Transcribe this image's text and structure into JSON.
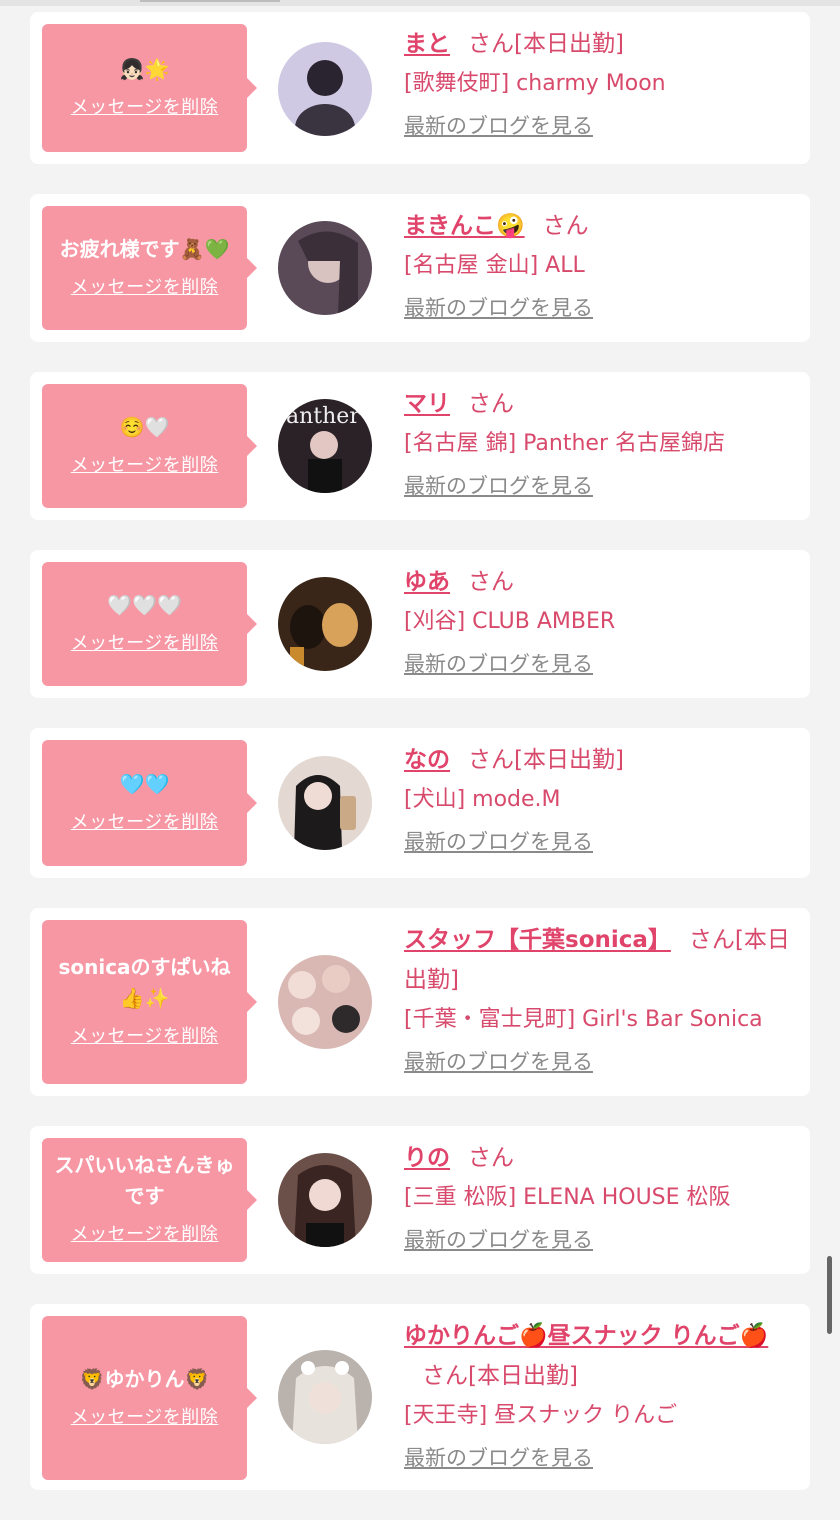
{
  "delete_label": "メッセージを削除",
  "blog_label": "最新のブログを見る",
  "san_label": "さん",
  "cards": [
    {
      "message": "👧🏻🌟",
      "name": "まと",
      "status": "[本日出勤]",
      "shop": "[歌舞伎町] charmy Moon",
      "avatar_color": "#cfc9e4"
    },
    {
      "message": "お疲れ様です🧸💚",
      "name": "まきんこ🤪",
      "status": "",
      "shop": "[名古屋 金山] ALL",
      "avatar_color": "#5a4a57"
    },
    {
      "message": "☺️🤍",
      "name": "マリ",
      "status": "",
      "shop": "[名古屋 錦] Panther 名古屋錦店",
      "avatar_color": "#2a2226"
    },
    {
      "message": "🤍🤍🤍",
      "name": "ゆあ",
      "status": "",
      "shop": "[刈谷] CLUB AMBER",
      "avatar_color": "#7a5331"
    },
    {
      "message": "🩵🩵",
      "name": "なの",
      "status": "[本日出勤]",
      "shop": "[犬山] mode.M",
      "avatar_color": "#d9cfca"
    },
    {
      "message": "sonicaのすぱいね👍✨",
      "name": "スタッフ【千葉sonica】",
      "status": "[本日出勤]",
      "shop": "[千葉・富士見町] Girl's Bar Sonica",
      "avatar_color": "#c9a7a2"
    },
    {
      "message": "スパいいねさんきゅです",
      "name": "りの",
      "status": "",
      "shop": "[三重 松阪] ELENA HOUSE 松阪",
      "avatar_color": "#6b5049"
    },
    {
      "message": "🦁ゆかりん🦁",
      "name": "ゆかりんご🍎昼スナック りんご🍎",
      "status": "[本日出勤]",
      "shop": "[天王寺] 昼スナック りんご",
      "avatar_color": "#b9b2ad"
    }
  ]
}
